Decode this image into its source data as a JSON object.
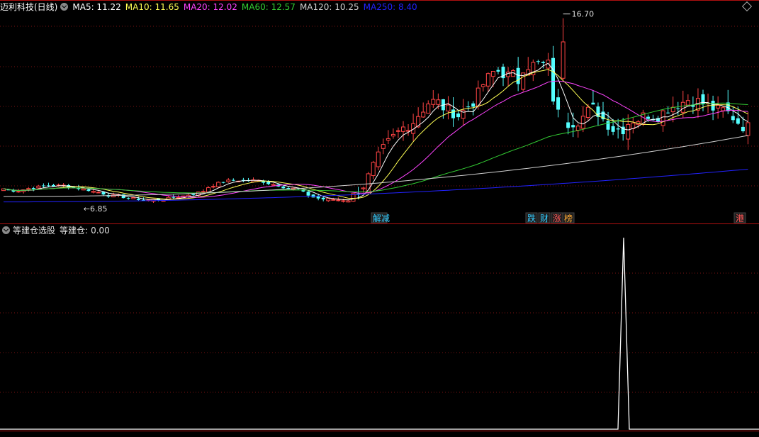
{
  "header": {
    "stock_title": "迈利科技(日线)",
    "ma": [
      {
        "label": "MA5",
        "value": "11.22",
        "color": "#ffffff"
      },
      {
        "label": "MA10",
        "value": "11.65",
        "color": "#ffff54"
      },
      {
        "label": "MA20",
        "value": "12.02",
        "color": "#ff44ff"
      },
      {
        "label": "MA60",
        "value": "12.57",
        "color": "#33cc33"
      },
      {
        "label": "MA120",
        "value": "10.25",
        "color": "#d0d0d0"
      },
      {
        "label": "MA250",
        "value": "8.40",
        "color": "#2222ff"
      }
    ]
  },
  "indicator": {
    "name": "等建仓选股",
    "label": "等建仓",
    "value": "0.00"
  },
  "annotations": {
    "high_label": "16.70",
    "low_label": "6.85",
    "event_tags": [
      {
        "text": "解减",
        "color": "#33ccff"
      },
      {
        "text": "跌",
        "color": "#33ccff"
      },
      {
        "text": "财",
        "color": "#33ccff"
      },
      {
        "text": "涨",
        "color": "#ff5555"
      },
      {
        "text": "榜",
        "color": "#ffaa33"
      },
      {
        "text": "港",
        "color": "#ff5555"
      }
    ]
  },
  "colors": {
    "up": "#ff4444",
    "down": "#54ffff",
    "grid": "#7a1212",
    "separator": "#b01010",
    "signal": "#ffffff"
  }
}
